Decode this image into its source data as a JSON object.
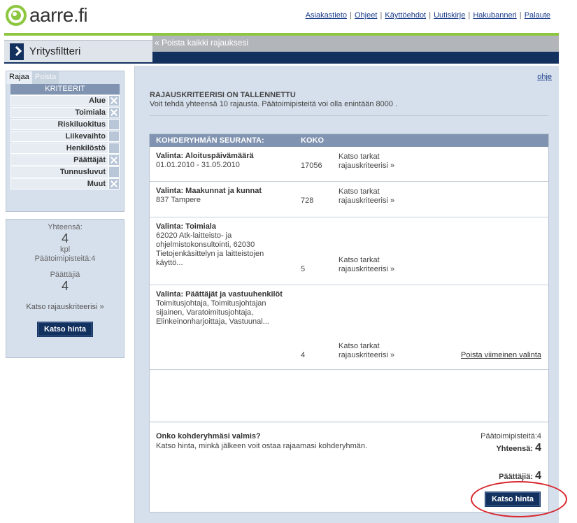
{
  "brand": {
    "name": "aarre.fi",
    "logo_color": "#8dc63f"
  },
  "top_links": [
    "Asiakastieto",
    "Ohjeet",
    "Käyttöehdot",
    "Uutiskirje",
    "Hakubanneri",
    "Palaute"
  ],
  "tab": {
    "label": "Yritysfiltteri",
    "clear_all": "« Poista kaikki rajauksesi"
  },
  "left_panel": {
    "tabs": {
      "active": "Rajaa",
      "inactive": "Poista"
    },
    "header": "KRITEERIT",
    "criteria": [
      {
        "label": "Alue",
        "removable": true
      },
      {
        "label": "Toimiala",
        "removable": true
      },
      {
        "label": "Riskiluokitus",
        "removable": false
      },
      {
        "label": "Liikevaihto",
        "removable": false
      },
      {
        "label": "Henkilöstö",
        "removable": false
      },
      {
        "label": "Päättäjät",
        "removable": true
      },
      {
        "label": "Tunnusluvut",
        "removable": false
      },
      {
        "label": "Muut",
        "removable": true
      }
    ]
  },
  "summary": {
    "total_label": "Yhteensä:",
    "total_value": "4",
    "unit": "kpl",
    "points": "Päätoimipisteitä:4",
    "deciders_label": "Päättäjiä",
    "deciders_value": "4",
    "view_criteria": "Katso rajauskriteerisi »",
    "price_button": "Katso hinta"
  },
  "main": {
    "help_link": "ohje",
    "saved_title": "RAJAUSKRITEERISI ON TALLENNETTU",
    "saved_text": "Voit tehdä yhteensä 10 rajausta. Päätoimipisteitä voi olla enintään 8000 .",
    "table": {
      "col_target": "KOHDERYHMÄN SEURANTA:",
      "col_size": "KOKO",
      "rows": [
        {
          "title": "Valinta: Aloituspäivämäärä",
          "detail": "01.01.2010 - 31.05.2010",
          "size": "17056",
          "link": "Katso tarkat rajauskriteerisi »"
        },
        {
          "title": "Valinta: Maakunnat ja kunnat",
          "detail": "837 Tampere",
          "size": "728",
          "link": "Katso tarkat rajauskriteerisi »"
        },
        {
          "title": "Valinta: Toimiala",
          "detail": "62020 Atk-laitteisto- ja ohjelmistokonsultointi, 62030 Tietojenkäsittelyn ja laitteistojen käyttö...",
          "size": "5",
          "link": "Katso tarkat rajauskriteerisi »"
        },
        {
          "title": "Valinta: Päättäjät ja vastuuhenkilöt",
          "detail": "Toimitusjohtaja, Toimitusjohtajan sijainen, Varatoimitusjohtaja, Elinkeinonharjoittaja, Vastuunal...",
          "size": "4",
          "link": "Katso tarkat rajauskriteerisi »",
          "remove": "Poista viimeinen valinta"
        }
      ]
    },
    "ready": {
      "title": "Onko kohderyhmäsi valmis?",
      "text": "Katso hinta, minkä jälkeen voit ostaa rajaamasi kohderyhmän.",
      "points": "Päätoimipisteitä:4",
      "total_label": "Yhteensä:",
      "total_value": "4",
      "deciders_label": "Päättäjiä:",
      "deciders_value": "4",
      "price_button": "Katso hinta"
    }
  },
  "colors": {
    "navy": "#13315f",
    "green": "#8dc63f",
    "panel": "#d6e0ec",
    "header": "#8093b0",
    "highlight": "#d9272e"
  }
}
